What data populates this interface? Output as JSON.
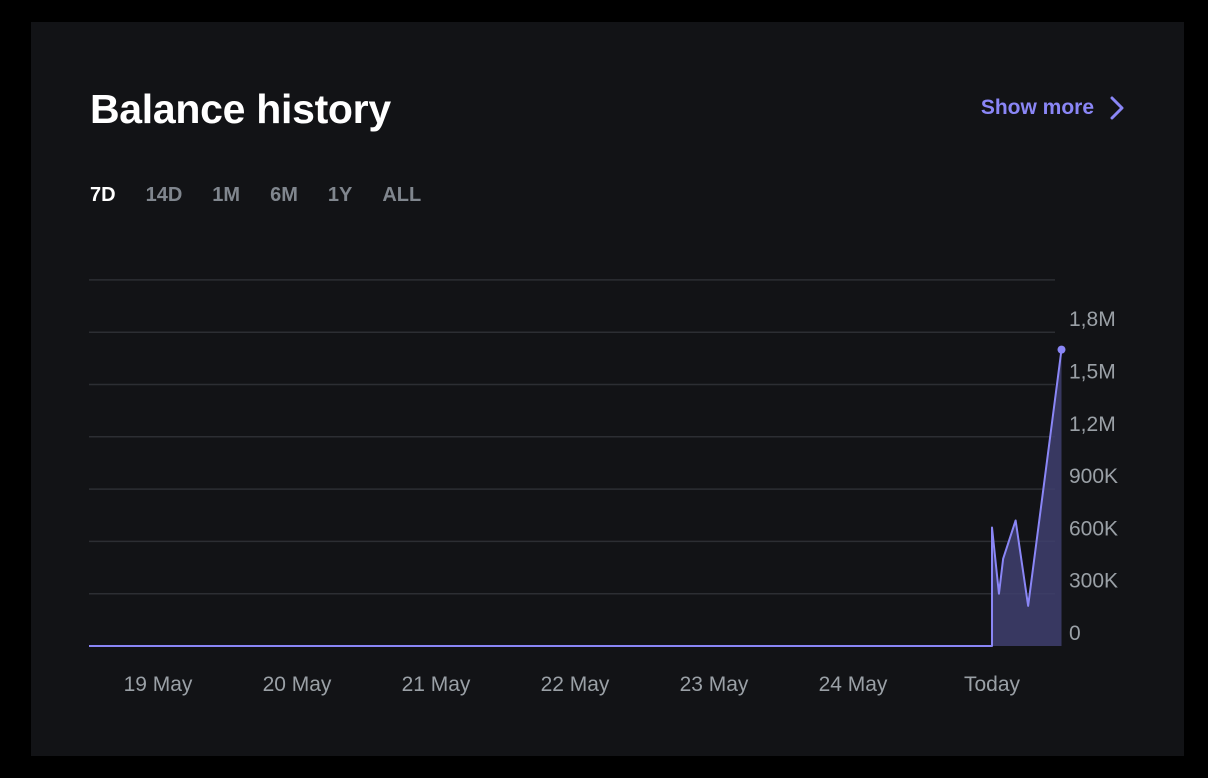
{
  "card": {
    "title": "Balance history",
    "show_more_label": "Show more"
  },
  "range_tabs": [
    {
      "label": "7D",
      "active": true
    },
    {
      "label": "14D",
      "active": false
    },
    {
      "label": "1M",
      "active": false
    },
    {
      "label": "6M",
      "active": false
    },
    {
      "label": "1Y",
      "active": false
    },
    {
      "label": "ALL",
      "active": false
    }
  ],
  "colors": {
    "background": "#121316",
    "accent": "#8a86f6",
    "area_fill": "#3f3f6e",
    "grid": "#2c2e33",
    "tick_text": "#9aa0a6"
  },
  "chart_data": {
    "type": "area",
    "title": "",
    "xlabel": "",
    "ylabel": "",
    "ylim": [
      0,
      2100000
    ],
    "grid": true,
    "y_axis_position": "right",
    "yticks": [
      {
        "value": 0,
        "label": "0"
      },
      {
        "value": 300000,
        "label": "300K"
      },
      {
        "value": 600000,
        "label": "600K"
      },
      {
        "value": 900000,
        "label": "900K"
      },
      {
        "value": 1200000,
        "label": "1,2M"
      },
      {
        "value": 1500000,
        "label": "1,5M"
      },
      {
        "value": 1800000,
        "label": "1,8M"
      }
    ],
    "xticks": [
      "19 May",
      "20 May",
      "21 May",
      "22 May",
      "23 May",
      "24 May",
      "Today"
    ],
    "points": [
      {
        "x": 0.0,
        "y": 0
      },
      {
        "x": 6.0,
        "y": 0
      },
      {
        "x": 6.0,
        "y": 680000
      },
      {
        "x": 6.05,
        "y": 300000
      },
      {
        "x": 6.08,
        "y": 500000
      },
      {
        "x": 6.17,
        "y": 720000
      },
      {
        "x": 6.26,
        "y": 230000
      },
      {
        "x": 6.5,
        "y": 1700000
      }
    ],
    "end_marker": true
  }
}
